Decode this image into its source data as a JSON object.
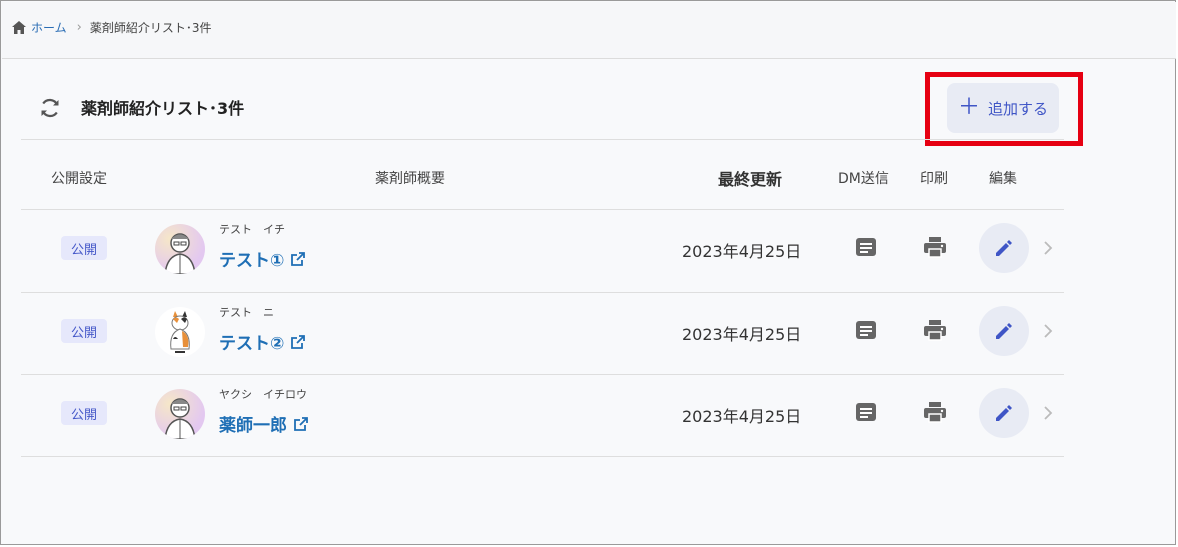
{
  "breadcrumb": {
    "home_label": "ホーム",
    "current_label": "薬剤師紹介リスト･3件"
  },
  "header": {
    "title": "薬剤師紹介リスト･3件",
    "add_button_label": "追加する",
    "highlight_color": "#e60012"
  },
  "columns": {
    "publish": "公開設定",
    "summary": "薬剤師概要",
    "updated": "最終更新",
    "dm": "DM送信",
    "print": "印刷",
    "edit": "編集"
  },
  "rows": [
    {
      "status": "公開",
      "kana": "テスト　イチ",
      "name": "テスト①",
      "updated": "2023年4月25日",
      "avatar": "person-avatar"
    },
    {
      "status": "公開",
      "kana": "テスト　ニ",
      "name": "テスト②",
      "updated": "2023年4月25日",
      "avatar": "cat-avatar"
    },
    {
      "status": "公開",
      "kana": "ヤクシ　イチロウ",
      "name": "薬師一郎",
      "updated": "2023年4月25日",
      "avatar": "person-avatar"
    }
  ],
  "colors": {
    "accent": "#3f55c6",
    "link": "#1f6fb5",
    "badge_bg": "#e6e8fb"
  }
}
